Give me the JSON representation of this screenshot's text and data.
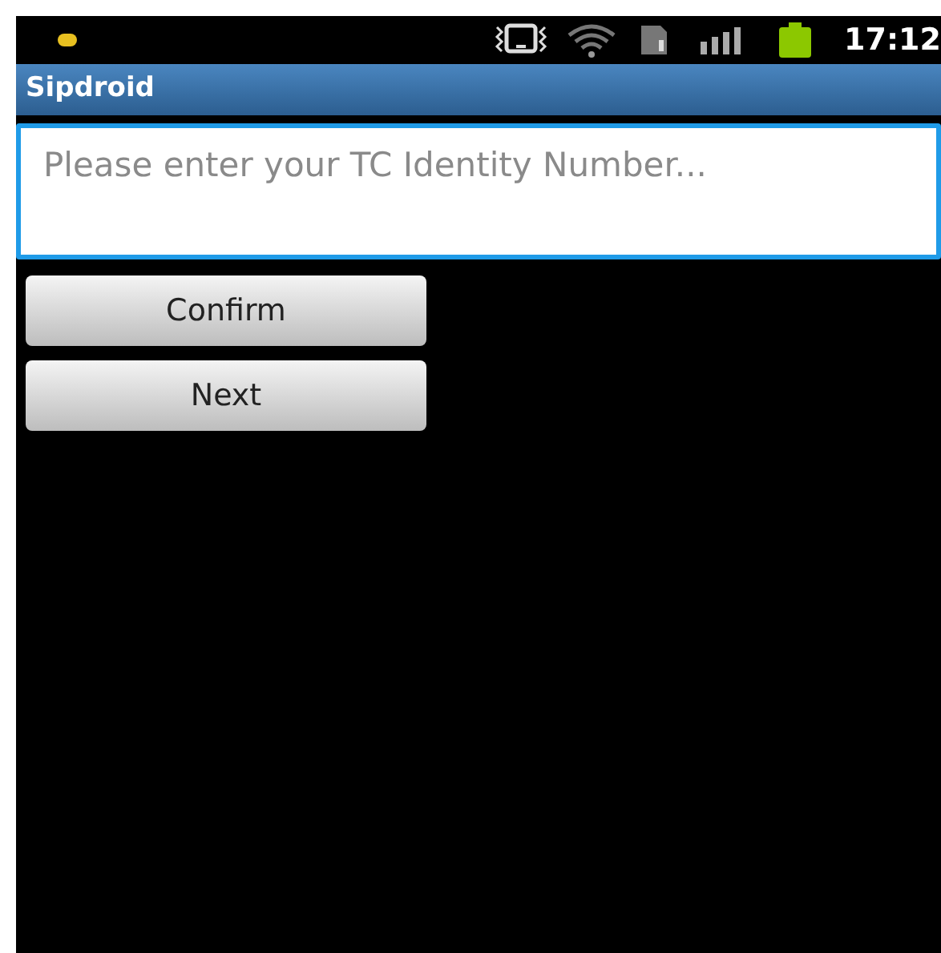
{
  "status_bar": {
    "time": "17:12"
  },
  "window": {
    "title": "Sipdroid"
  },
  "id_field": {
    "placeholder": "Please enter your TC Identity Number..."
  },
  "buttons": [
    "Confirm",
    "Next"
  ]
}
